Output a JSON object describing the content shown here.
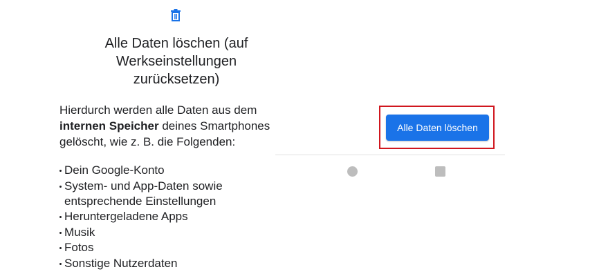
{
  "dialog": {
    "icon": "trash-icon",
    "title_lines": [
      "Alle Daten löschen (auf",
      "Werkseinstellungen",
      "zurücksetzen)"
    ],
    "description": {
      "line1": "Hierdurch werden alle Daten aus dem",
      "bold": "internen Speicher",
      "line2_rest": " deines Smartphones",
      "line3": "gelöscht, wie z. B. die Folgenden:"
    },
    "items": [
      "Dein Google-Konto",
      "System- und App-Daten sowie",
      "entsprechende Einstellungen",
      "Heruntergeladene Apps",
      "Musik",
      "Fotos",
      "Sonstige Nutzerdaten"
    ]
  },
  "action": {
    "button_label": "Alle Daten löschen"
  },
  "navbar": {
    "home_icon": "home-circle-icon",
    "recents_icon": "recents-square-icon"
  },
  "colors": {
    "accent": "#1a73e8",
    "highlight": "#d0161e",
    "nav_icon": "#bdbdbd"
  }
}
